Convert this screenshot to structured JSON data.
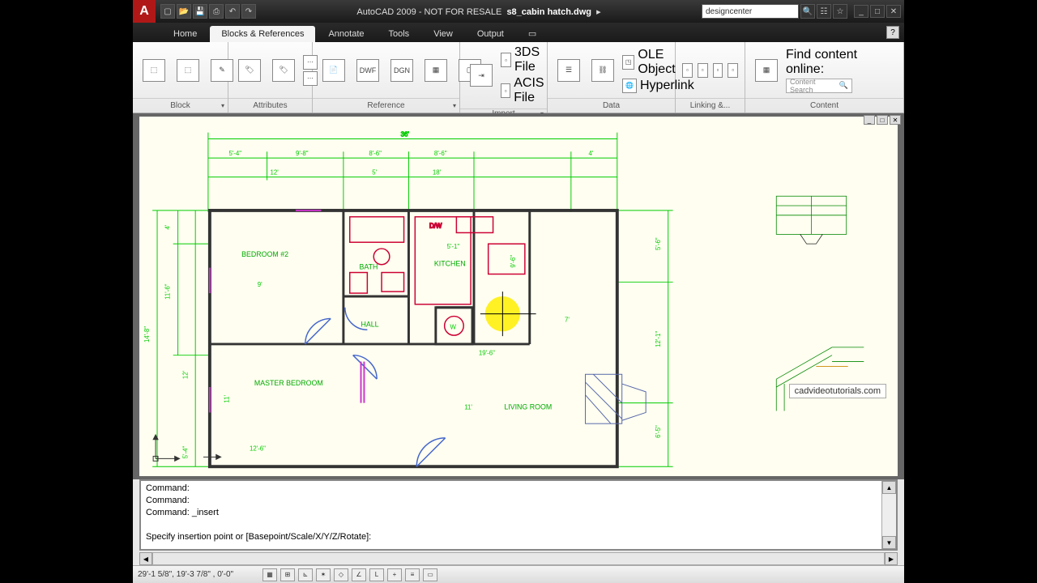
{
  "title": {
    "app": "AutoCAD 2009 - NOT FOR RESALE",
    "file": "s8_cabin hatch.dwg"
  },
  "search_value": "designcenter",
  "tabs": [
    "Home",
    "Blocks & References",
    "Annotate",
    "Tools",
    "View",
    "Output"
  ],
  "active_tab": 1,
  "panels": {
    "block": "Block",
    "attributes": "Attributes",
    "reference": "Reference",
    "import": "Import",
    "data": "Data",
    "linking": "Linking &...",
    "content": "Content"
  },
  "ref_btns": [
    "DWF",
    "DGN"
  ],
  "import_items": [
    "3DS File",
    "ACIS File"
  ],
  "data_items": [
    "OLE Object",
    "Hyperlink"
  ],
  "content_label": "Find content online:",
  "content_placeholder": "Content Search",
  "rooms": {
    "bedroom2": "BEDROOM #2",
    "bath": "BATH",
    "kitchen": "KITCHEN",
    "hall": "HALL",
    "master": "MASTER BEDROOM",
    "living": "LIVING ROOM",
    "dw": "D/W",
    "w": "W"
  },
  "dims": {
    "top_total": "36'",
    "r1": [
      "5'-4\"",
      "9'-8\"",
      "8'-6\"",
      "8'-6\"",
      "4'"
    ],
    "r2": [
      "12'",
      "5'",
      "18'"
    ],
    "left_total": "14'-8\"",
    "left_a": "4'",
    "left_b": "11'-6\"",
    "left_c": "12'",
    "left_d": "5'-4\"",
    "k_51": "5'-1\"",
    "k_96": "9'-6\"",
    "k_7": "7'",
    "k_196": "19'-6\"",
    "mb_9": "9'",
    "mb_11": "11'",
    "mb_126": "12'-6\"",
    "lr_11": "11'",
    "r_56": "5'-6\"",
    "r_121": "12'-1\"",
    "r_65": "6'-5\""
  },
  "cmd_lines": [
    "Command:",
    "Command:",
    "Command: _insert",
    "",
    "Specify insertion point or [Basepoint/Scale/X/Y/Z/Rotate]:"
  ],
  "status_coords": "29'-1 5/8\", 19'-3 7/8\" , 0'-0\"",
  "watermark": "cadvideotutorials.com"
}
